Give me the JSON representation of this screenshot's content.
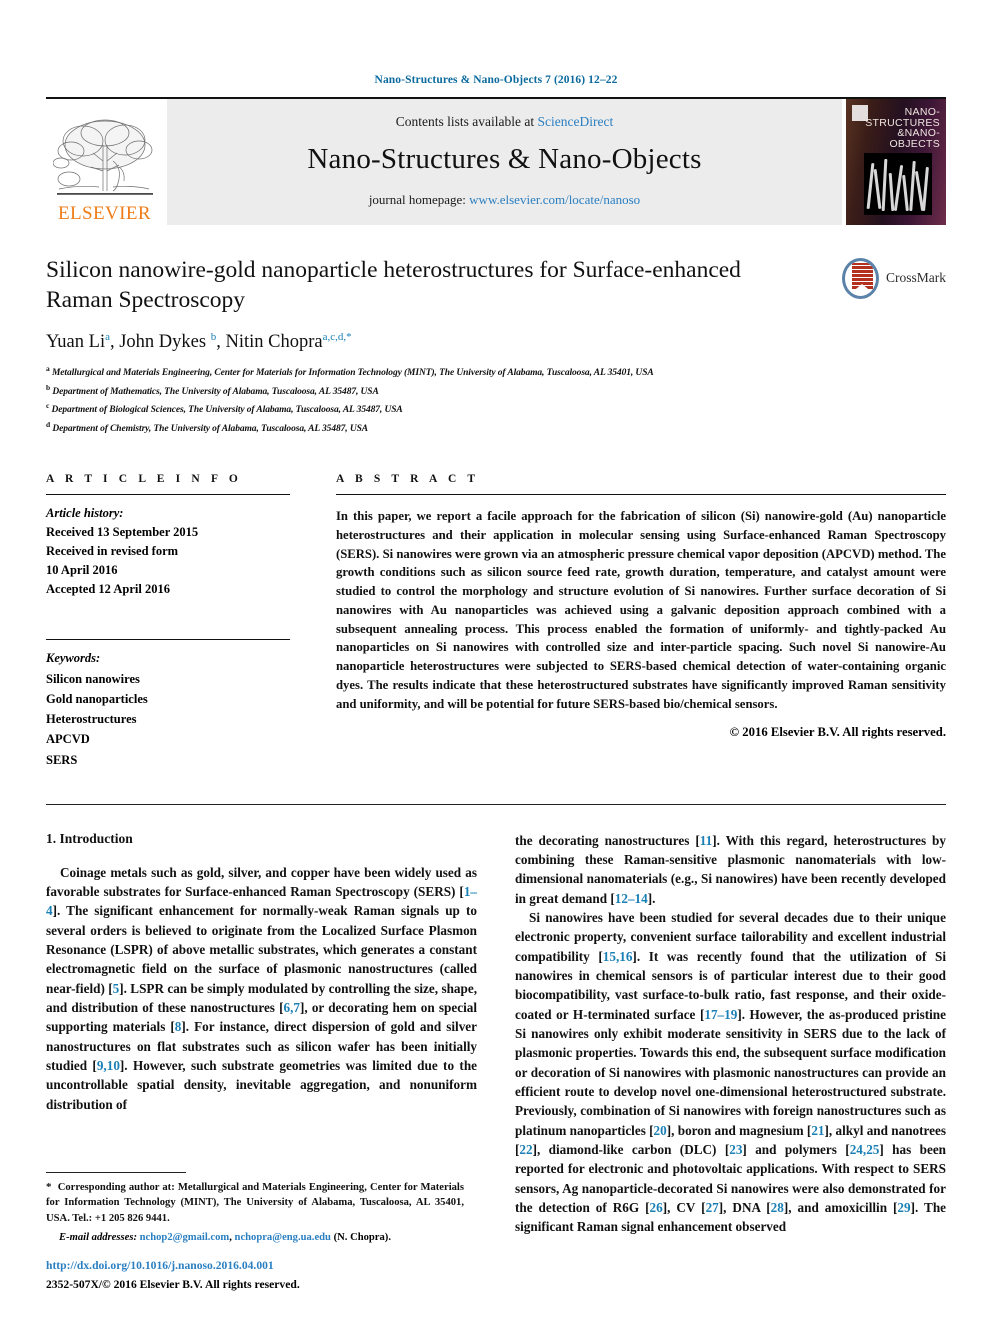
{
  "running_head": "Nano-Structures & Nano-Objects 7 (2016) 12–22",
  "masthead": {
    "publisher_name": "ELSEVIER",
    "contents_prefix": "Contents lists available at ",
    "contents_link": "ScienceDirect",
    "journal_title": "Nano-Structures & Nano-Objects",
    "homepage_prefix": "journal homepage: ",
    "homepage_link": "www.elsevier.com/locate/nanoso",
    "cover": {
      "line1": "NANO-",
      "line2": "STRUCTURES",
      "line3": "&NANO-",
      "line4": "OBJECTS"
    }
  },
  "article": {
    "title": "Silicon nanowire-gold nanoparticle heterostructures for Surface-enhanced Raman Spectroscopy",
    "authors": [
      {
        "name": "Yuan Li",
        "marks": "a"
      },
      {
        "name": "John Dykes",
        "marks": "b"
      },
      {
        "name": "Nitin Chopra",
        "marks": "a,c,d,*"
      }
    ],
    "crossmark_label": "CrossMark",
    "affiliations": [
      {
        "mark": "a",
        "text": "Metallurgical and Materials Engineering, Center for Materials for Information Technology (MINT), The University of Alabama, Tuscaloosa, AL 35401, USA"
      },
      {
        "mark": "b",
        "text": "Department of Mathematics, The University of Alabama, Tuscaloosa, AL 35487, USA"
      },
      {
        "mark": "c",
        "text": "Department of Biological Sciences, The University of Alabama, Tuscaloosa, AL 35487, USA"
      },
      {
        "mark": "d",
        "text": "Department of Chemistry, The University of Alabama, Tuscaloosa, AL 35487, USA"
      }
    ]
  },
  "article_info": {
    "heading": "A R T I C L E    I N F O",
    "history_label": "Article history:",
    "history": [
      "Received 13 September 2015",
      "Received in revised form",
      "10 April 2016",
      "Accepted 12 April 2016"
    ],
    "keywords_label": "Keywords:",
    "keywords": [
      "Silicon nanowires",
      "Gold nanoparticles",
      "Heterostructures",
      "APCVD",
      "SERS"
    ]
  },
  "abstract": {
    "heading": "A B S T R A C T",
    "body": "In this paper, we report a facile approach for the fabrication of silicon (Si) nanowire-gold (Au) nanoparticle heterostructures and their application in molecular sensing using Surface-enhanced Raman Spectroscopy (SERS). Si nanowires were grown via an atmospheric pressure chemical vapor deposition (APCVD) method. The growth conditions such as silicon source feed rate, growth duration, temperature, and catalyst amount were studied to control the morphology and structure evolution of Si nanowires. Further surface decoration of Si nanowires with Au nanoparticles was achieved using a galvanic deposition approach combined with a subsequent annealing process. This process enabled the formation of uniformly- and tightly-packed Au nanoparticles on Si nanowires with controlled size and inter-particle spacing. Such novel Si nanowire-Au nanoparticle heterostructures were subjected to SERS-based chemical detection of water-containing organic dyes. The results indicate that these heterostructured substrates have significantly improved Raman sensitivity and uniformity, and will be potential for future SERS-based bio/chemical sensors.",
    "copyright": "© 2016 Elsevier B.V. All rights reserved."
  },
  "introduction": {
    "heading": "1. Introduction",
    "left_paragraph": "Coinage metals such as gold, silver, and copper have been widely used as favorable substrates for Surface-enhanced Raman Spectroscopy (SERS) [1–4]. The significant enhancement for normally-weak Raman signals up to several orders is believed to originate from the Localized Surface Plasmon Resonance (LSPR) of above metallic substrates, which generates a constant electromagnetic field on the surface of plasmonic nanostructures (called near-field) [5]. LSPR can be simply modulated by controlling the size, shape, and distribution of these nanostructures [6,7], or decorating hem on special supporting materials [8]. For instance, direct dispersion of gold and silver nanostructures on flat substrates such as silicon wafer has been initially studied [9,10]. However, such substrate geometries was limited due to the uncontrollable spatial density, inevitable aggregation, and nonuniform distribution of",
    "right_paragraph_1": "the decorating nanostructures [11]. With this regard, heterostructures by combining these Raman-sensitive plasmonic nanomaterials with low-dimensional nanomaterials (e.g., Si nanowires) have been recently developed in great demand [12–14].",
    "right_paragraph_2": "Si nanowires have been studied for several decades due to their unique electronic property, convenient surface tailorability and excellent industrial compatibility [15,16]. It was recently found that the utilization of Si nanowires in chemical sensors is of particular interest due to their good biocompatibility, vast surface-to-bulk ratio, fast response, and their oxide-coated or H-terminated surface [17–19]. However, the as-produced pristine Si nanowires only exhibit moderate sensitivity in SERS due to the lack of plasmonic properties. Towards this end, the subsequent surface modification or decoration of Si nanowires with plasmonic nanostructures can provide an efficient route to develop novel one-dimensional heterostructured substrate. Previously, combination of Si nanowires with foreign nanostructures such as platinum nanoparticles [20], boron and magnesium [21], alkyl and nanotrees [22], diamond-like carbon (DLC) [23] and polymers [24,25] has been reported for electronic and photovoltaic applications. With respect to SERS sensors, Ag nanoparticle-decorated Si nanowires were also demonstrated for the detection of R6G [26], CV [27], DNA [28], and amoxicillin [29]. The significant Raman signal enhancement observed"
  },
  "footnote": {
    "corresponding": "Corresponding author at: Metallurgical and Materials Engineering, Center for Materials for Information Technology (MINT), The University of Alabama, Tuscaloosa, AL 35401, USA. Tel.: +1 205 826 9441.",
    "email_label": "E-mail addresses:",
    "email_1": "nchop2@gmail.com",
    "email_2": "nchopra@eng.ua.edu",
    "email_suffix": "(N. Chopra).",
    "doi": "http://dx.doi.org/10.1016/j.nanoso.2016.04.001",
    "issn": "2352-507X/© 2016 Elsevier B.V. All rights reserved."
  },
  "colors": {
    "link_blue": "#2a7fc1",
    "ref_blue": "#1a7fb5",
    "head_blue": "#0b6a9e",
    "elsevier_orange": "#ef7d18",
    "band_gray": "#ececec"
  }
}
